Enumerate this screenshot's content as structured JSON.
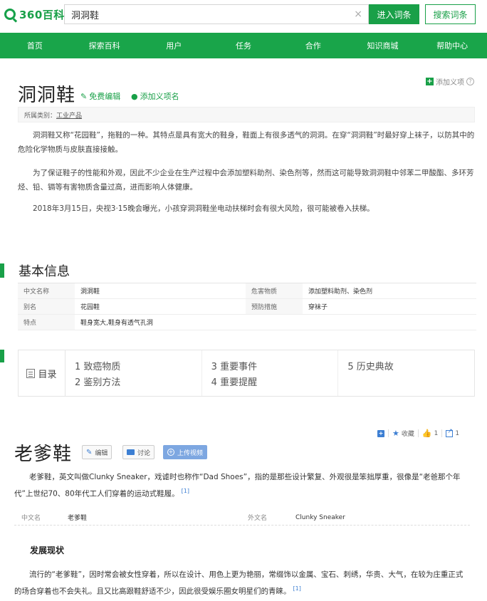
{
  "header": {
    "logo_text": "360百科",
    "search_value": "洞洞鞋",
    "enter_label": "进入词条",
    "search_label": "搜索词条",
    "clear_glyph": "×"
  },
  "nav": {
    "items": [
      "首页",
      "探索百科",
      "用户",
      "任务",
      "合作",
      "知识商城",
      "帮助中心"
    ]
  },
  "entry1": {
    "title": "洞洞鞋",
    "edit_label": "免费编辑",
    "add_label": "添加义项名",
    "add_meaning_label": "添加义项",
    "category_prefix": "所属类别：",
    "category": "工业产品",
    "paragraphs": [
      "洞洞鞋又称“花园鞋”，拖鞋的一种。其特点是具有宽大的鞋身，鞋面上有很多透气的洞洞。在穿“洞洞鞋”时最好穿上袜子，以防其中的危险化学物质与皮肤直接接触。",
      "为了保证鞋子的性能和外观，因此不少企业在生产过程中会添加塑料助剂、染色剂等，然而这可能导致洞洞鞋中邻苯二甲酸酯、多环芳烃、铅、镉等有害物质含量过高，进而影响人体健康。",
      "2018年3月15日，央视3·15晚会曝光，小孩穿洞洞鞋坐电动扶梯时会有很大风险，很可能被卷入扶梯。"
    ],
    "basic_info_title": "基本信息",
    "basic_info": [
      {
        "k1": "中文名称",
        "v1": "洞洞鞋",
        "k2": "危害物质",
        "v2": "添加塑料助剂、染色剂"
      },
      {
        "k1": "别名",
        "v1": "花园鞋",
        "k2": "预防措施",
        "v2": "穿袜子"
      },
      {
        "k1": "特点",
        "v1": "鞋身宽大,鞋身有透气孔洞",
        "k2": "",
        "v2": ""
      }
    ],
    "toc_label": "目录",
    "toc_columns": [
      [
        "1 致癌物质",
        "2 鉴别方法"
      ],
      [
        "3 重要事件",
        "4 重要提醒"
      ],
      [
        "5 历史典故"
      ]
    ]
  },
  "entry2": {
    "toolbar": {
      "favorite_label": "收藏",
      "like_count": "1",
      "share_count": "1"
    },
    "title": "老爹鞋",
    "edit_label": "编辑",
    "discuss_label": "讨论",
    "upload_label": "上传视频",
    "intro": "老爹鞋，英文叫做Clunky Sneaker，戏谑时也称作“Dad Shoes”，指的是那些设计繁复、外观很是笨拙厚重，很像是“老爸那个年代”上世纪70、80年代工人们穿着的运动式鞋履。",
    "intro_ref": "[1]",
    "info": {
      "k1": "中文名",
      "v1": "老爹鞋",
      "k2": "外文名",
      "v2": "Clunky Sneaker"
    },
    "sub_title": "发展现状",
    "body": "流行的“老爹鞋”，因时常会被女性穿着，所以在设计、用色上更为艳丽，常缀饰以金属、宝石、刺绣，华贵、大气，在较为庄重正式的场合穿着也不会失礼。且又比高跟鞋舒适不少，因此很受娱乐圈女明星们的青睐。",
    "body_ref": "[1]"
  },
  "colors": {
    "brand_green": "#19a048",
    "accent_blue": "#3d7fd3"
  }
}
